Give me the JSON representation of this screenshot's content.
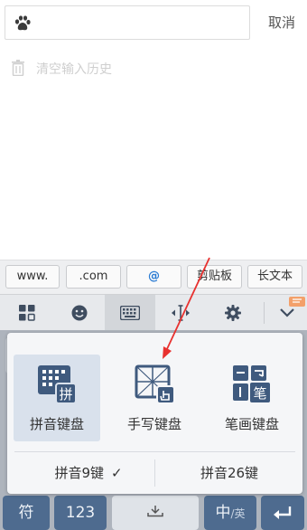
{
  "search": {
    "placeholder": "",
    "cancel_label": "取消"
  },
  "history": {
    "clear_label": "清空输入历史"
  },
  "candidates": [
    {
      "label": "www."
    },
    {
      "label": ".com"
    },
    {
      "label": "@"
    },
    {
      "label": "剪贴板"
    },
    {
      "label": "长文本"
    }
  ],
  "toolbar": {
    "icons": [
      "apps-icon",
      "emoji-icon",
      "keyboard-icon",
      "cursor-move-icon",
      "settings-icon",
      "collapse-icon"
    ]
  },
  "keyboard_switcher": {
    "options": [
      {
        "label": "拼音键盘",
        "badge": "拼",
        "selected": true
      },
      {
        "label": "手写键盘",
        "badge": "",
        "selected": false
      },
      {
        "label": "笔画键盘",
        "badge": "笔",
        "selected": false
      }
    ],
    "modes": [
      {
        "label": "拼音9键",
        "checked": true
      },
      {
        "label": "拼音26键",
        "checked": false
      }
    ]
  },
  "bottom_keys": {
    "symbol": "符",
    "number": "123",
    "lang_main": "中",
    "lang_sub": "/英"
  },
  "colors": {
    "accent": "#4e6b8f",
    "arrow": "#e8312f",
    "chip_at": "#2b7cd3"
  }
}
